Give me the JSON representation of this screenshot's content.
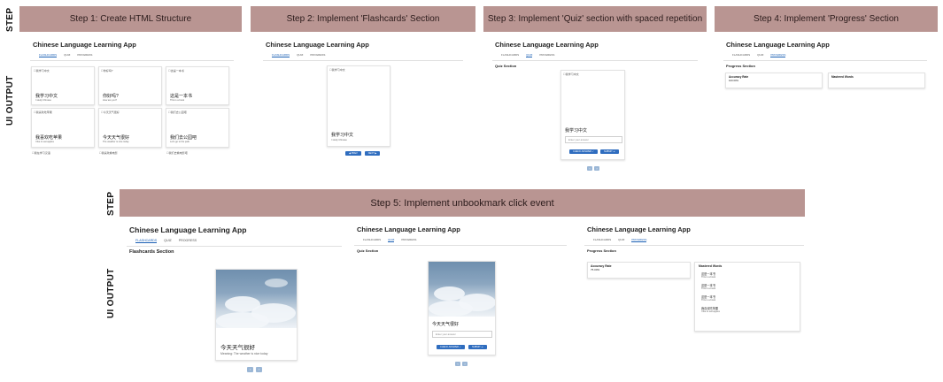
{
  "labels": {
    "step": "STEP",
    "ui_output": "UI OUTPUT"
  },
  "steps": [
    "Step 1: Create HTML Structure",
    "Step 2: Implement 'Flashcards' Section",
    "Step 3: Implement 'Quiz' section with spaced repetition",
    "Step 4: Implement 'Progress' Section",
    "Step 5: Implement unbookmark click event"
  ],
  "app": {
    "title": "Chinese Language Learning App",
    "tabs": [
      "FLASHCARDS",
      "QUIZ",
      "PROGRESS"
    ]
  },
  "sections": {
    "flashcards": "Flashcards Section",
    "quiz": "Quiz Section",
    "progress": "Progress Section"
  },
  "bookmark_glyph": "☐",
  "step1_cards": [
    {
      "tag": "我学习中文",
      "zh": "我学习中文",
      "en": "I study Chinese"
    },
    {
      "tag": "你好吗?",
      "zh": "你好吗?",
      "en": "How are you?"
    },
    {
      "tag": "这是一本书",
      "zh": "这是一本书",
      "en": "This is a book"
    },
    {
      "tag": "我喜欢吃苹果",
      "zh": "我喜欢吃苹果",
      "en": "I like to eat apples"
    },
    {
      "tag": "今天天气很好",
      "zh": "今天天气很好",
      "en": "The weather is nice today"
    },
    {
      "tag": "我们去公园吧",
      "zh": "我们去公园吧",
      "en": "Let's go to the park"
    },
    {
      "tag": "我在学习汉语",
      "zh": "",
      "en": ""
    },
    {
      "tag": "我喜欢看电影",
      "zh": "",
      "en": ""
    },
    {
      "tag": "我们去看电影吧",
      "zh": "",
      "en": ""
    }
  ],
  "step2": {
    "tag": "我学习中文",
    "zh": "我学习中文",
    "en": "I study Chinese",
    "prev": "PREV",
    "next": "NEXT"
  },
  "step3": {
    "tag": "我学习中文",
    "zh": "我学习中文",
    "placeholder": "Enter your answer",
    "check": "CHECK ANSWER",
    "submit": "SUBMIT"
  },
  "step4": {
    "rate_label": "Accuracy Rate",
    "rate": "100.00%",
    "mastered": "Mastered Words"
  },
  "step5_flash": {
    "zh": "今天天气很好",
    "en": "Meaning: The weather is nice today"
  },
  "step5_quiz": {
    "zh": "今天天气很好",
    "placeholder": "Enter your answer",
    "check": "CHECK ANSWER",
    "submit": "SUBMIT"
  },
  "step5_progress": {
    "rate_label": "Accuracy Rate",
    "rate": "75.00%",
    "mastered": "Mastered Words",
    "words": [
      {
        "zh": "这是一本书",
        "en": "This is a book"
      },
      {
        "zh": "这是一本书",
        "en": "This is a book"
      },
      {
        "zh": "这是一本书",
        "en": "This is a book"
      },
      {
        "zh": "我喜欢吃苹果",
        "en": "I like to eat apples"
      }
    ]
  }
}
